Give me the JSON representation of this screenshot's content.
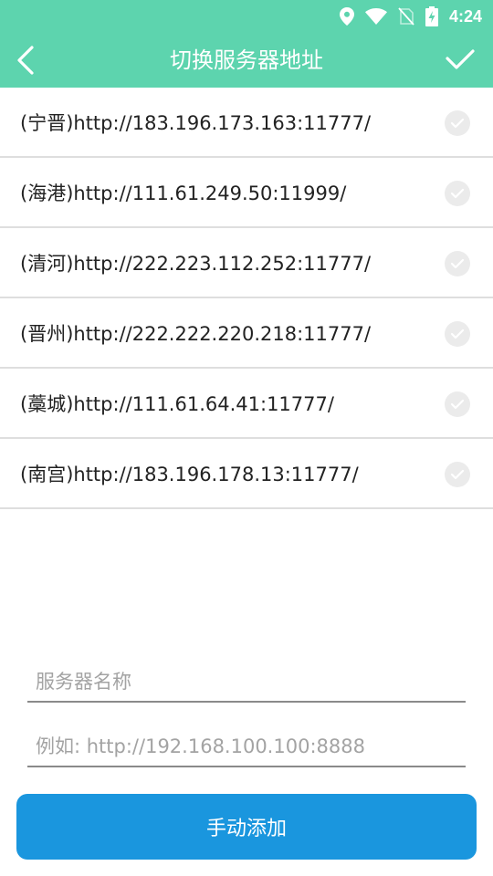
{
  "status_bar": {
    "time": "4:24",
    "icons": [
      "location-icon",
      "wifi-icon",
      "no-sim-icon",
      "battery-charging-icon"
    ]
  },
  "app_bar": {
    "title": "切换服务器地址",
    "back_icon": "chevron-left-icon",
    "confirm_icon": "checkmark-icon",
    "color": "#5dd4ae"
  },
  "servers": [
    {
      "label": "(宁晋)http://183.196.173.163:11777/"
    },
    {
      "label": "(海港)http://111.61.249.50:11999/"
    },
    {
      "label": "(清河)http://222.223.112.252:11777/"
    },
    {
      "label": "(晋州)http://222.222.220.218:11777/"
    },
    {
      "label": "(藁城)http://111.61.64.41:11777/"
    },
    {
      "label": "(南宫)http://183.196.178.13:11777/"
    }
  ],
  "form": {
    "name_placeholder": "服务器名称",
    "url_placeholder": "例如: http://192.168.100.100:8888",
    "add_label": "手动添加",
    "add_color": "#1a96de"
  }
}
